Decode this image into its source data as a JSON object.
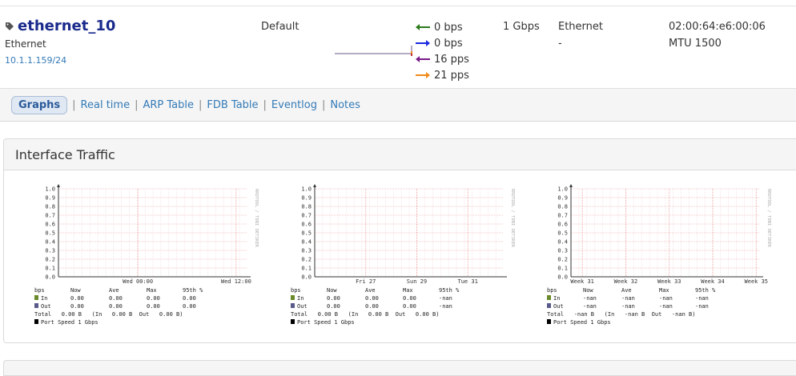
{
  "interface": {
    "name": "ethernet_10",
    "type": "Ethernet",
    "ip": "10.1.1.159/24",
    "group": "Default",
    "speed": "1 Gbps",
    "media": "Ethernet",
    "media_secondary": "-",
    "mac": "02:00:64:e6:00:06",
    "mtu": "MTU 1500",
    "rates": [
      {
        "value": "0 bps",
        "color": "#2a7a1a",
        "direction": "left"
      },
      {
        "value": "0 bps",
        "color": "#1a2ae0",
        "direction": "right"
      },
      {
        "value": "16 pps",
        "color": "#7a1a8a",
        "direction": "left"
      },
      {
        "value": "21 pps",
        "color": "#f08a1a",
        "direction": "right"
      }
    ]
  },
  "tabs": {
    "active": "Graphs",
    "links": [
      "Real time",
      "ARP Table",
      "FDB Table",
      "Eventlog",
      "Notes"
    ],
    "separator": "|"
  },
  "panel": {
    "title": "Interface Traffic"
  },
  "graphs": [
    {
      "y_ticks": [
        "1.0",
        "0.9",
        "0.8",
        "0.7",
        "0.6",
        "0.5",
        "0.4",
        "0.3",
        "0.2",
        "0.1",
        "0.0"
      ],
      "x_ticks": [
        "Wed 00:00",
        "Wed 12:00"
      ],
      "x_tick_pos": [
        0.42,
        0.94
      ],
      "watermark": "RRDTOOL / TOBI OETIKER",
      "legend_header": [
        "bps",
        "Now",
        "Ave",
        "Max",
        "95th %"
      ],
      "in_row": [
        "In",
        "0.00",
        "0.00",
        "0.00",
        "0.00"
      ],
      "out_row": [
        "Out",
        "0.00",
        "0.00",
        "0.00",
        "0.00"
      ],
      "total": "Total   0.00 B   (In   0.00 B  Out   0.00 B)",
      "port_speed": "Port Speed 1 Gbps"
    },
    {
      "y_ticks": [
        "1.0",
        "0.9",
        "0.8",
        "0.7",
        "0.6",
        "0.5",
        "0.4",
        "0.3",
        "0.2",
        "0.1",
        "0.0"
      ],
      "x_ticks": [
        "Fri 27",
        "Sun 29",
        "Tue 31"
      ],
      "x_tick_pos": [
        0.27,
        0.54,
        0.81
      ],
      "watermark": "RRDTOOL / TOBI OETIKER",
      "legend_header": [
        "bps",
        "Now",
        "Ave",
        "Max",
        "95th %"
      ],
      "in_row": [
        "In",
        "0.00",
        "0.00",
        "0.00",
        "-nan"
      ],
      "out_row": [
        "Out",
        "0.00",
        "0.00",
        "0.00",
        "-nan"
      ],
      "total": "Total   0.00 B   (In   0.00 B  Out   0.00 B)",
      "port_speed": "Port Speed 1 Gbps"
    },
    {
      "y_ticks": [
        "1.0",
        "0.9",
        "0.8",
        "0.7",
        "0.6",
        "0.5",
        "0.4",
        "0.3",
        "0.2",
        "0.1",
        "0.0"
      ],
      "x_ticks": [
        "Week 31",
        "Week 32",
        "Week 33",
        "Week 34",
        "Week 35"
      ],
      "x_tick_pos": [
        0.06,
        0.29,
        0.52,
        0.75,
        0.98
      ],
      "watermark": "RRDTOOL / TOBI OETIKER",
      "legend_header": [
        "bps",
        "Now",
        "Ave",
        "Max",
        "95th %"
      ],
      "in_row": [
        "In",
        "-nan",
        "-nan",
        "-nan",
        "-nan"
      ],
      "out_row": [
        "Out",
        "-nan",
        "-nan",
        "-nan",
        "-nan"
      ],
      "total": "Total   -nan B   (In   -nan B  Out   -nan B)",
      "port_speed": "Port Speed 1 Gbps"
    }
  ]
}
